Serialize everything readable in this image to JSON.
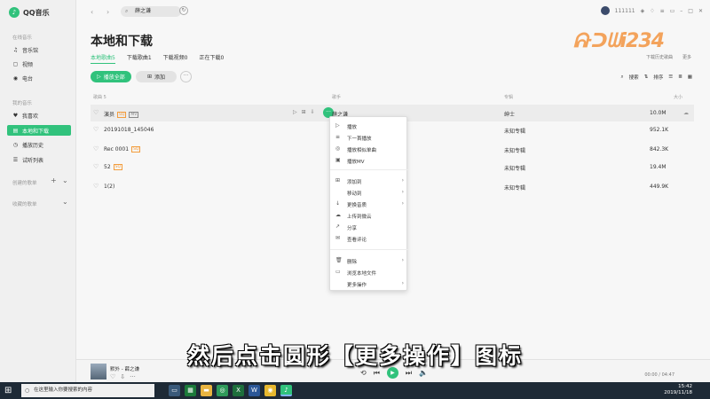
{
  "app": {
    "name": "QQ音乐"
  },
  "sidebar": {
    "section_online": "在线音乐",
    "online_items": [
      {
        "label": "音乐馆",
        "icon": "♫"
      },
      {
        "label": "视频",
        "icon": "▢"
      },
      {
        "label": "电台",
        "icon": "◉"
      }
    ],
    "section_mine": "我的音乐",
    "mine_items": [
      {
        "label": "我喜欢",
        "icon": "♥"
      },
      {
        "label": "本地和下载",
        "icon": "▤"
      },
      {
        "label": "播放历史",
        "icon": "◷"
      },
      {
        "label": "试听列表",
        "icon": "☰"
      }
    ],
    "created_playlists": "创建的歌单",
    "collected_playlists": "收藏的歌单"
  },
  "topbar": {
    "search_text": "薛之谦",
    "user": "111111"
  },
  "page": {
    "title": "本地和下载",
    "tabs": [
      "本地歌曲5",
      "下载歌曲1",
      "下载视频0",
      "正在下载0"
    ],
    "play_all": "播放全部",
    "add": "添加",
    "search_tool": "搜索",
    "sort_tool": "排序"
  },
  "watermark": {
    "text": "ᕱᑝᗯi234",
    "sub1": "下载历史歌曲",
    "sub2": "更多"
  },
  "table": {
    "headers": [
      "歌曲 5",
      "歌手",
      "专辑",
      "大小"
    ],
    "rows": [
      {
        "title": "演员",
        "tags": [
          "SQ",
          "MV"
        ],
        "artist": "薛之谦",
        "album": "绅士",
        "size": "10.0M"
      },
      {
        "title": "20191018_145046",
        "tags": [],
        "artist": "",
        "album": "未知专辑",
        "size": "952.1K"
      },
      {
        "title": "Rec 0001",
        "tags": [
          "SQ"
        ],
        "artist": "",
        "album": "未知专辑",
        "size": "842.3K"
      },
      {
        "title": "52",
        "tags": [
          "SQ"
        ],
        "artist": "",
        "album": "未知专辑",
        "size": "19.4M"
      },
      {
        "title": "1(2)",
        "tags": [],
        "artist": "",
        "album": "未知专辑",
        "size": "449.9K"
      }
    ]
  },
  "context_menu": {
    "items": [
      {
        "label": "播放",
        "icon": "▷",
        "arrow": false
      },
      {
        "label": "下一首播放",
        "icon": "≡",
        "arrow": false
      },
      {
        "label": "播放相似单曲",
        "icon": "◎",
        "arrow": false
      },
      {
        "label": "播放MV",
        "icon": "▣",
        "arrow": false
      },
      {
        "label": "添加到",
        "icon": "⊞",
        "arrow": true
      },
      {
        "label": "移动到",
        "icon": "",
        "arrow": true
      },
      {
        "label": "更换音质",
        "icon": "↓",
        "arrow": true
      },
      {
        "label": "上传到微云",
        "icon": "☁",
        "arrow": false
      },
      {
        "label": "分享",
        "icon": "↗",
        "arrow": false
      },
      {
        "label": "查看评论",
        "icon": "✉",
        "arrow": false
      },
      {
        "label": "删除",
        "icon": "🗑",
        "arrow": true
      },
      {
        "label": "浏览本地文件",
        "icon": "▭",
        "arrow": false
      },
      {
        "label": "更多操作",
        "icon": "",
        "arrow": true
      }
    ]
  },
  "subtitle": "然后点击圆形【更多操作】图标",
  "player": {
    "song": "默外 - 薛之谦",
    "time": "00:00 / 04:47"
  },
  "taskbar": {
    "search_placeholder": "在这里输入你要搜索的内容",
    "time": "15:42",
    "date": "2019/11/18"
  },
  "colors": {
    "accent": "#31c27c"
  }
}
